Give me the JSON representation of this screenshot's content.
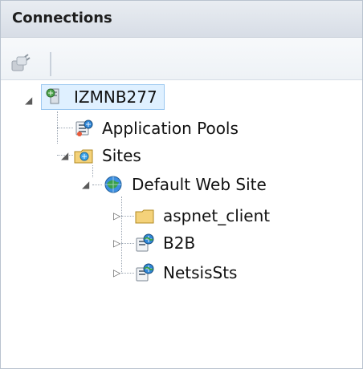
{
  "header": {
    "title": "Connections"
  },
  "toolbar": {
    "buttons": [
      {
        "name": "connect",
        "icon": "plug-icon"
      }
    ]
  },
  "tree": {
    "nodes": [
      {
        "label": "IZMNB277",
        "icon": "server-icon",
        "expanded": true,
        "selected": true
      },
      {
        "label": "Application Pools",
        "icon": "app-pools-icon"
      },
      {
        "label": "Sites",
        "icon": "sites-folder-icon",
        "expanded": true
      },
      {
        "label": "Default Web Site",
        "icon": "globe-icon",
        "expanded": true
      },
      {
        "label": "aspnet_client",
        "icon": "folder-icon",
        "expanded": false
      },
      {
        "label": "B2B",
        "icon": "web-app-icon",
        "expanded": false
      },
      {
        "label": "NetsisSts",
        "icon": "web-app-icon",
        "expanded": false
      }
    ]
  },
  "colors": {
    "selection_bg": "#dff0ff",
    "selection_border": "#9cc8f0",
    "header_bg": "#d7dde6"
  }
}
